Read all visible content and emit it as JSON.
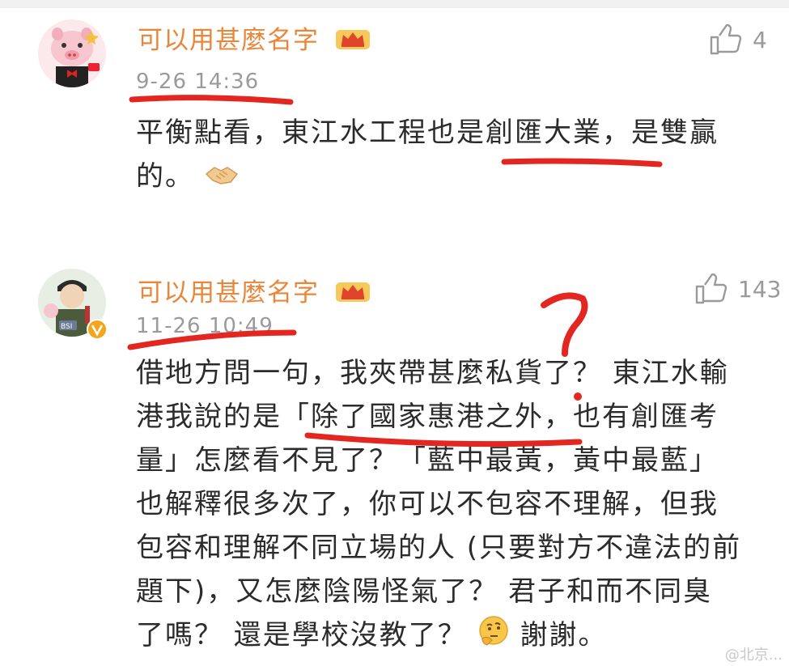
{
  "comments": [
    {
      "username": "可以用甚麼名字",
      "timestamp": "9-26 14:36",
      "likes": "4",
      "lines": [
        "平衡點看，東江水工程也是創匯大業，是雙贏",
        "的。"
      ],
      "emoji": "handshake-emoji"
    },
    {
      "username": "可以用甚麼名字",
      "timestamp": "11-26 10:49",
      "likes": "143",
      "lines": [
        "借地方問一句，我夾帶甚麼私貨了？ 東江水輸",
        "港我說的是「除了國家惠港之外，也有創匯考",
        "量」怎麼看不見了？「藍中最黃，黃中最藍」",
        "也解釋很多次了，你可以不包容不理解，但我",
        "包容和理解不同立場的人 (只要對方不違法的前",
        "題下)，又怎麼陰陽怪氣了？ 君子和而不同臭",
        "了嗎？ 還是學校沒教了？"
      ],
      "closing": "謝謝。",
      "emoji": "thinking-emoji",
      "avatar_badge": "BSI"
    }
  ],
  "watermark": "@北京..."
}
